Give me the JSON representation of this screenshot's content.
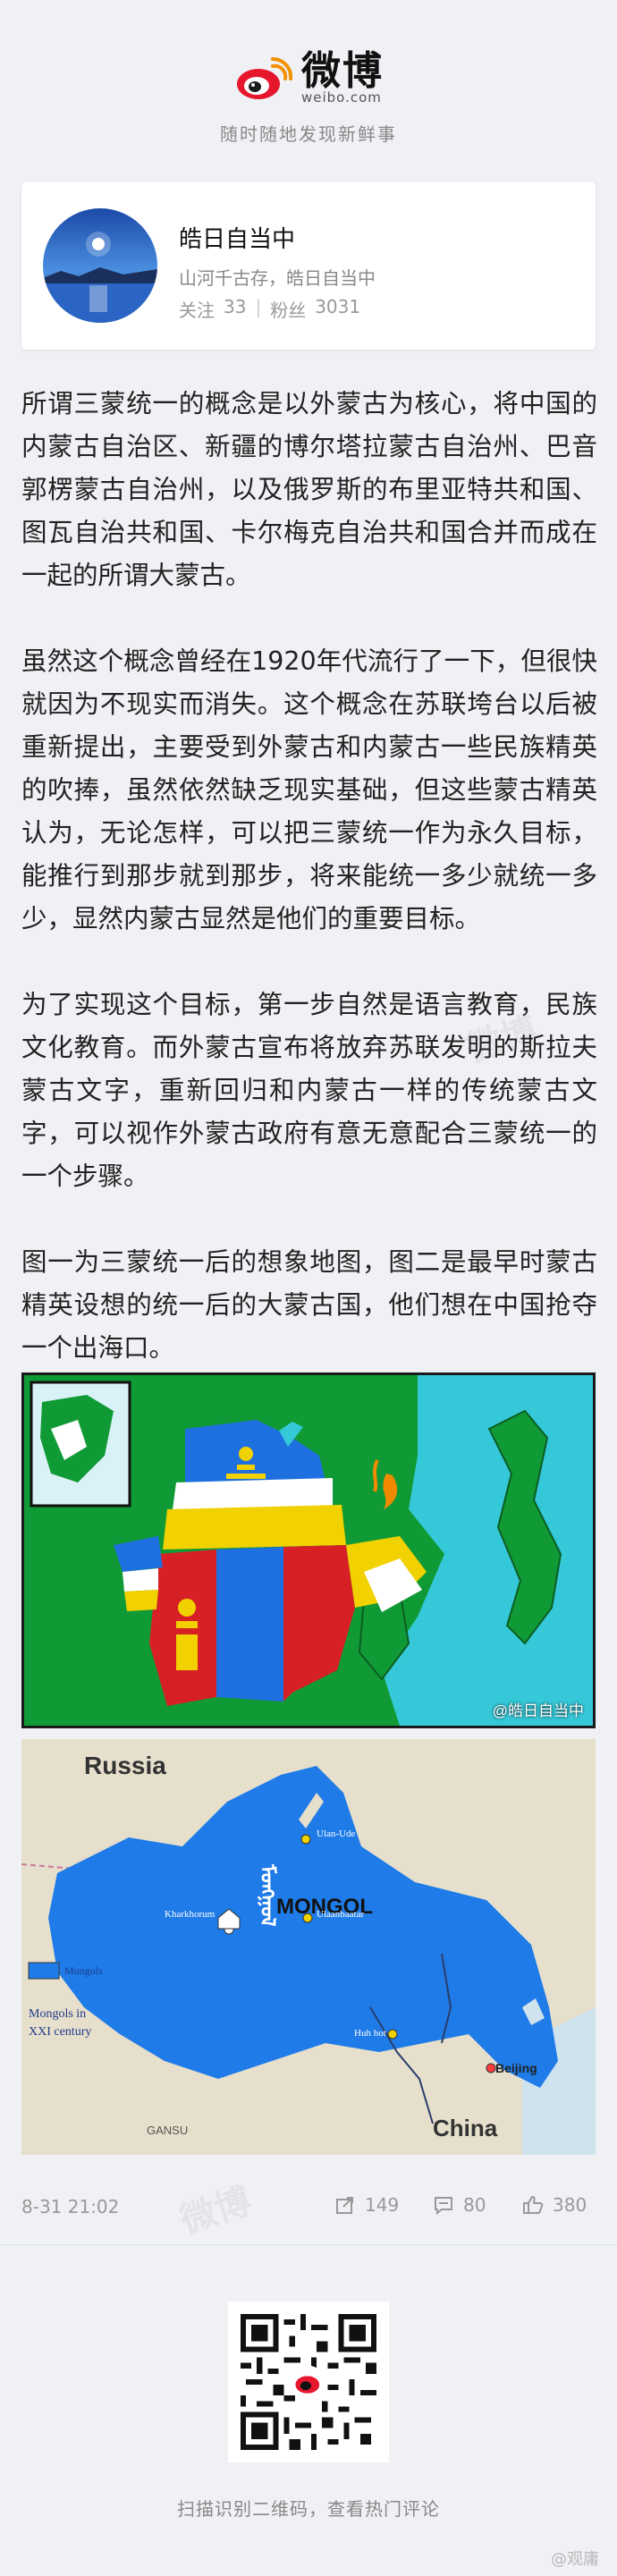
{
  "brand": {
    "name": "微博",
    "domain": "weibo.com",
    "slogan": "随时随地发现新鲜事"
  },
  "author": {
    "name": "皓日自当中",
    "bio": "山河千古存，皓日自当中",
    "follow_label": "关注",
    "follow_count": "33",
    "fans_label": "粉丝",
    "fans_count": "3031"
  },
  "article": {
    "paragraphs": [
      "所谓三蒙统一的概念是以外蒙古为核心，将中国的内蒙古自治区、新疆的博尔塔拉蒙古自治州、巴音郭楞蒙古自治州，以及俄罗斯的布里亚特共和国、图瓦自治共和国、卡尔梅克自治共和国合并而成在一起的所谓大蒙古。",
      "虽然这个概念曾经在1920年代流行了一下，但很快就因为不现实而消失。这个概念在苏联垮台以后被重新提出，主要受到外蒙古和内蒙古一些民族精英的吹捧，虽然依然缺乏现实基础，但这些蒙古精英认为，无论怎样，可以把三蒙统一作为永久目标，能推行到那步就到那步，将来能统一多少就统一多少，显然内蒙古显然是他们的重要目标。",
      "为了实现这个目标，第一步自然是语言教育，民族文化教育。而外蒙古宣布将放弃苏联发明的斯拉夫蒙古文字，重新回归和内蒙古一样的传统蒙古文字，可以视作外蒙古政府有意无意配合三蒙统一的一个步骤。",
      "图一为三蒙统一后的想象地图，图二是最早时蒙古精英设想的统一后的大蒙古国，他们想在中国抢夺一个出海口。"
    ]
  },
  "map1": {
    "watermark": "@皓日自当中"
  },
  "map2": {
    "label_russia": "Russia",
    "label_china": "China",
    "label_mongol": "MONGOL",
    "label_ulanude": "Ulan-Ude",
    "label_ulaanbaatar": "Ulaanbaatar",
    "label_kharkhorum": "Kharkhorum",
    "label_huhhot": "Huh hot",
    "label_beijing": "Beijing",
    "label_gansu": "GANSU",
    "label_legend": "Mongols",
    "label_caption_1": "Mongols in",
    "label_caption_2": "XXI century"
  },
  "meta": {
    "time": "8-31 21:02",
    "share_count": "149",
    "comment_count": "80",
    "like_count": "380"
  },
  "footer": {
    "qr_hint": "扫描识别二维码，查看热门评论",
    "corner_watermark": "@观庸"
  },
  "colors": {
    "page_bg": "#eff1f4",
    "brand_red": "#e6162d",
    "mongol_blue": "#1e6fe0"
  }
}
